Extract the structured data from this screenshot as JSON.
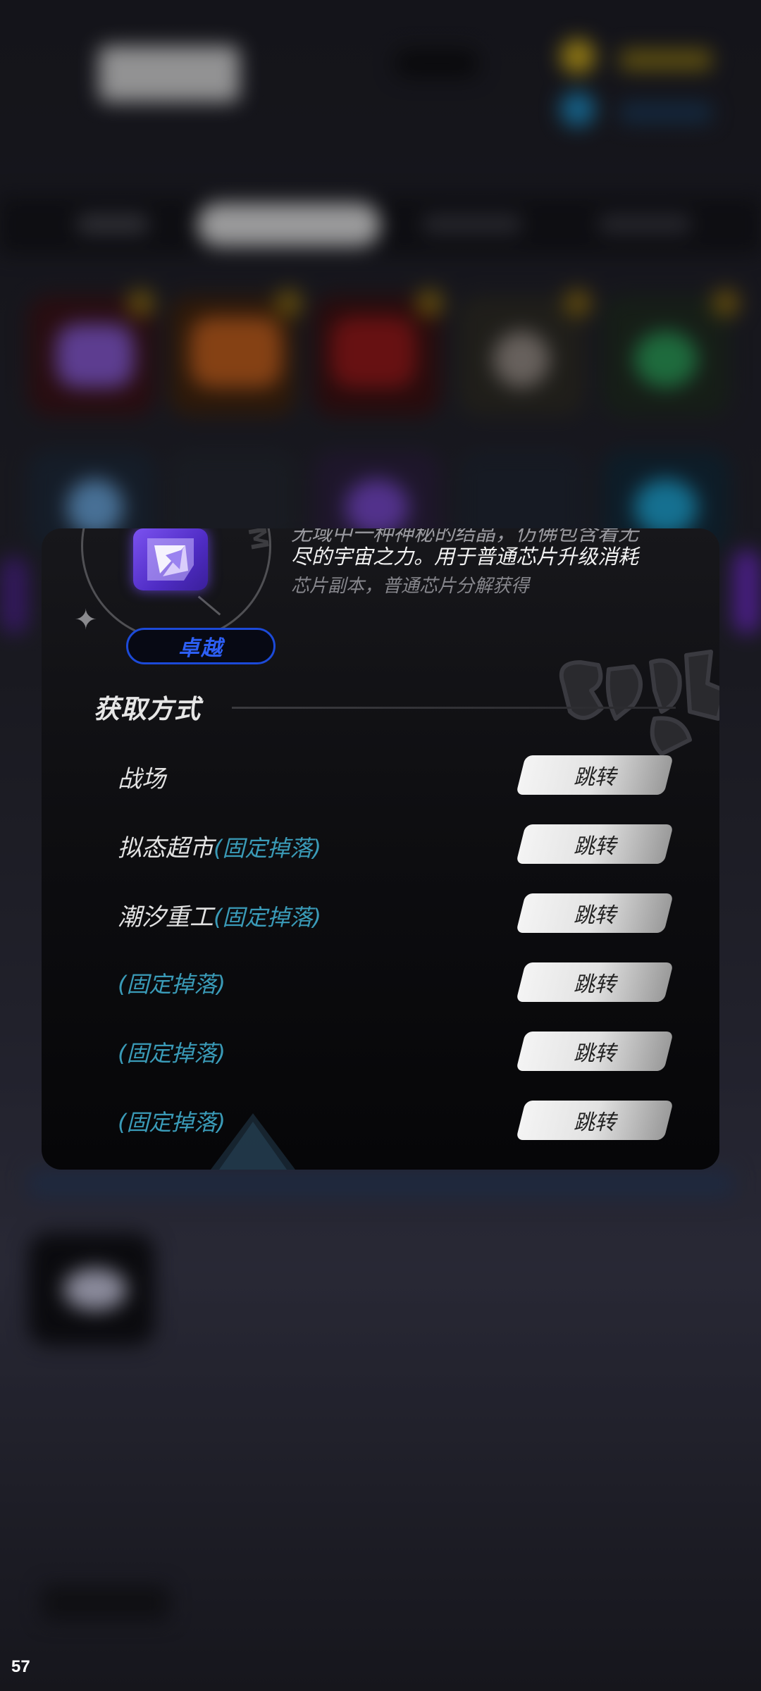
{
  "item": {
    "description_line1": "无域中一种神秘的结晶，仿佛包含着无",
    "description_line2": "尽的宇宙之力。用于普通芯片升级消耗",
    "source_note": "芯片副本，普通芯片分解获得",
    "rarity": "卓越",
    "icon": "purple-crystal-icon"
  },
  "acquisition": {
    "title": "获取方式",
    "rows": [
      {
        "label": "战场",
        "tag": "",
        "button": "跳转"
      },
      {
        "label": "拟态超市",
        "tag": "(固定掉落)",
        "button": "跳转"
      },
      {
        "label": "潮汐重工",
        "tag": "(固定掉落)",
        "button": "跳转"
      },
      {
        "label": "",
        "tag": "(固定掉落)",
        "button": "跳转"
      },
      {
        "label": "",
        "tag": "(固定掉落)",
        "button": "跳转"
      },
      {
        "label": "",
        "tag": "(固定掉落)",
        "button": "跳转"
      }
    ]
  },
  "overlay": {
    "fps": "57"
  },
  "colors": {
    "rarity_blue": "#2d5ff5",
    "tag_teal": "#3a9bb8",
    "modal_bg": "#0e0e11"
  }
}
